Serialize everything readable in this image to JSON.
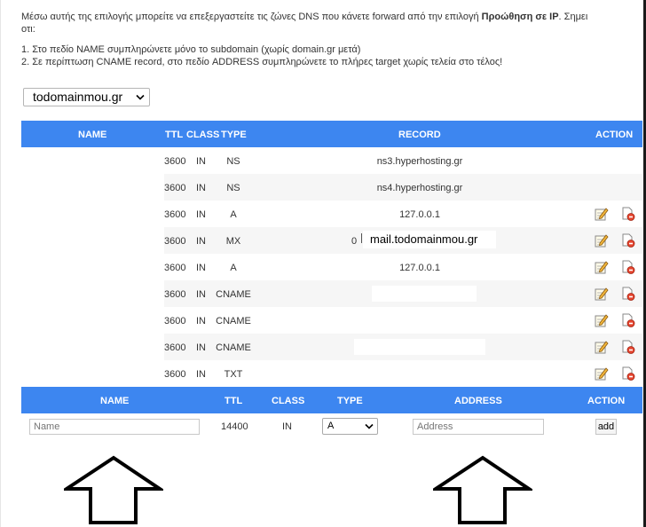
{
  "intro": {
    "line1_prefix": "Μέσω αυτής της επιλογής μπορείτε να επεξεργαστείτε τις ζώνες DNS που κάνετε forward από την επιλογή ",
    "line1_bold": "Προώθηση σε IP",
    "line1_suffix": ". Σημει",
    "line1_cont": "οτι:",
    "note1": "1. Στο πεδίο NAME συμπληρώνετε μόνο το subdomain (χωρίς domain.gr μετά)",
    "note2": "2. Σε περίπτωση CNAME record, στο πεδίο ADDRESS συμπληρώνετε το πλήρες target χωρίς τελεία στο τέλος!"
  },
  "domain_select": {
    "value": "todomainmou.gr"
  },
  "table_header": {
    "name": "NAME",
    "ttl": "TTL",
    "class": "CLASS",
    "type": "TYPE",
    "record": "RECORD",
    "action": "ACTION"
  },
  "records": [
    {
      "ttl": "3600",
      "class": "IN",
      "type": "NS",
      "record": "ns3.hyperhosting.gr",
      "actions": false
    },
    {
      "ttl": "3600",
      "class": "IN",
      "type": "NS",
      "record": "ns4.hyperhosting.gr",
      "actions": false
    },
    {
      "ttl": "3600",
      "class": "IN",
      "type": "A",
      "record": "127.0.0.1",
      "actions": true
    },
    {
      "ttl": "3600",
      "class": "IN",
      "type": "MX",
      "priority": "0",
      "record": "mail.todomainmou.gr",
      "actions": true
    },
    {
      "ttl": "3600",
      "class": "IN",
      "type": "A",
      "record": "127.0.0.1",
      "actions": true
    },
    {
      "ttl": "3600",
      "class": "IN",
      "type": "CNAME",
      "record": "",
      "actions": true
    },
    {
      "ttl": "3600",
      "class": "IN",
      "type": "CNAME",
      "record": "",
      "actions": true
    },
    {
      "ttl": "3600",
      "class": "IN",
      "type": "CNAME",
      "record": "",
      "actions": true
    },
    {
      "ttl": "3600",
      "class": "IN",
      "type": "TXT",
      "record": "",
      "actions": true
    }
  ],
  "add_header": {
    "name": "NAME",
    "ttl": "TTL",
    "class": "CLASS",
    "type": "TYPE",
    "address": "ADDRESS",
    "action": "ACTION"
  },
  "add_form": {
    "name_placeholder": "Name",
    "ttl": "14400",
    "class": "IN",
    "type_value": "A",
    "address_placeholder": "Address",
    "add_label": "add"
  },
  "icons": {
    "edit": "edit-pencil-icon",
    "delete": "delete-icon",
    "annotation": "up-arrow-icon"
  },
  "colors": {
    "header_bg": "#3d86f0",
    "header_text": "#ffffff",
    "row_alt": "#f6f6f6"
  }
}
